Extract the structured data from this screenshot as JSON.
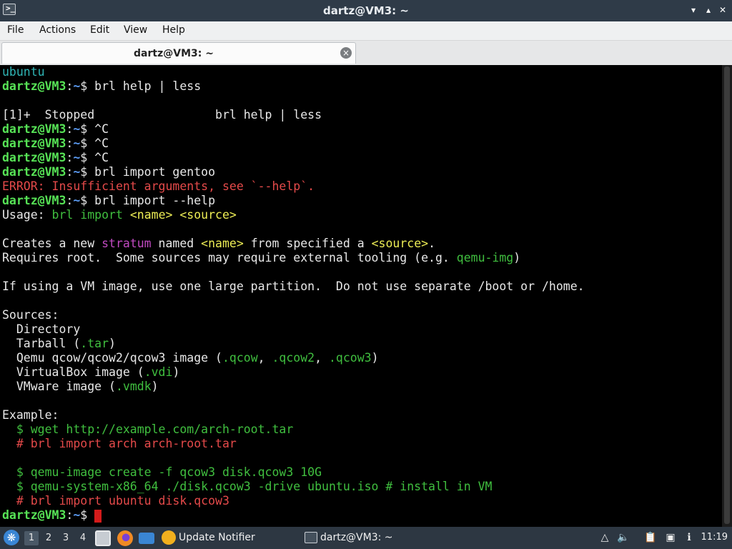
{
  "window": {
    "title": "dartz@VM3: ~",
    "app_icon_glyph": ">_"
  },
  "menu": {
    "items": [
      "File",
      "Actions",
      "Edit",
      "View",
      "Help"
    ]
  },
  "tab": {
    "label": "dartz@VM3: ~",
    "close_glyph": "×"
  },
  "terminal": {
    "user_host": "dartz@VM3",
    "path": "~",
    "lines": [
      [
        {
          "t": "ubuntu",
          "c": "cy"
        }
      ],
      [
        {
          "t": "dartz@VM3",
          "c": "pu"
        },
        {
          "t": ":",
          "c": ""
        },
        {
          "t": "~",
          "c": "pp"
        },
        {
          "t": "$ brl help | less",
          "c": ""
        }
      ],
      [
        {
          "t": "",
          "c": ""
        }
      ],
      [
        {
          "t": "[1]+  Stopped                 brl help | less",
          "c": ""
        }
      ],
      [
        {
          "t": "dartz@VM3",
          "c": "pu"
        },
        {
          "t": ":",
          "c": ""
        },
        {
          "t": "~",
          "c": "pp"
        },
        {
          "t": "$ ^C",
          "c": ""
        }
      ],
      [
        {
          "t": "dartz@VM3",
          "c": "pu"
        },
        {
          "t": ":",
          "c": ""
        },
        {
          "t": "~",
          "c": "pp"
        },
        {
          "t": "$ ^C",
          "c": ""
        }
      ],
      [
        {
          "t": "dartz@VM3",
          "c": "pu"
        },
        {
          "t": ":",
          "c": ""
        },
        {
          "t": "~",
          "c": "pp"
        },
        {
          "t": "$ ^C",
          "c": ""
        }
      ],
      [
        {
          "t": "dartz@VM3",
          "c": "pu"
        },
        {
          "t": ":",
          "c": ""
        },
        {
          "t": "~",
          "c": "pp"
        },
        {
          "t": "$ brl import gentoo",
          "c": ""
        }
      ],
      [
        {
          "t": "ERROR: Insufficient arguments, see `--help`.",
          "c": "rd"
        }
      ],
      [
        {
          "t": "dartz@VM3",
          "c": "pu"
        },
        {
          "t": ":",
          "c": ""
        },
        {
          "t": "~",
          "c": "pp"
        },
        {
          "t": "$ brl import --help",
          "c": ""
        }
      ],
      [
        {
          "t": "Usage: ",
          "c": ""
        },
        {
          "t": "brl import",
          "c": "gr"
        },
        {
          "t": " ",
          "c": ""
        },
        {
          "t": "<name>",
          "c": "yl"
        },
        {
          "t": " ",
          "c": ""
        },
        {
          "t": "<source>",
          "c": "yl"
        }
      ],
      [
        {
          "t": "",
          "c": ""
        }
      ],
      [
        {
          "t": "Creates a new ",
          "c": ""
        },
        {
          "t": "stratum",
          "c": "mg"
        },
        {
          "t": " named ",
          "c": ""
        },
        {
          "t": "<name>",
          "c": "yl"
        },
        {
          "t": " from specified a ",
          "c": ""
        },
        {
          "t": "<source>",
          "c": "yl"
        },
        {
          "t": ".",
          "c": ""
        }
      ],
      [
        {
          "t": "Requires root.  Some sources may require external tooling (e.g. ",
          "c": ""
        },
        {
          "t": "qemu-img",
          "c": "gr"
        },
        {
          "t": ")",
          "c": ""
        }
      ],
      [
        {
          "t": "",
          "c": ""
        }
      ],
      [
        {
          "t": "If using a VM image, use one large partition.  Do not use separate /boot or /home.",
          "c": ""
        }
      ],
      [
        {
          "t": "",
          "c": ""
        }
      ],
      [
        {
          "t": "Sources:",
          "c": ""
        }
      ],
      [
        {
          "t": "  Directory",
          "c": ""
        }
      ],
      [
        {
          "t": "  Tarball (",
          "c": ""
        },
        {
          "t": ".tar",
          "c": "gr"
        },
        {
          "t": ")",
          "c": ""
        }
      ],
      [
        {
          "t": "  Qemu qcow/qcow2/qcow3 image (",
          "c": ""
        },
        {
          "t": ".qcow",
          "c": "gr"
        },
        {
          "t": ", ",
          "c": ""
        },
        {
          "t": ".qcow2",
          "c": "gr"
        },
        {
          "t": ", ",
          "c": ""
        },
        {
          "t": ".qcow3",
          "c": "gr"
        },
        {
          "t": ")",
          "c": ""
        }
      ],
      [
        {
          "t": "  VirtualBox image (",
          "c": ""
        },
        {
          "t": ".vdi",
          "c": "gr"
        },
        {
          "t": ")",
          "c": ""
        }
      ],
      [
        {
          "t": "  VMware image (",
          "c": ""
        },
        {
          "t": ".vmdk",
          "c": "gr"
        },
        {
          "t": ")",
          "c": ""
        }
      ],
      [
        {
          "t": "",
          "c": ""
        }
      ],
      [
        {
          "t": "Example:",
          "c": ""
        }
      ],
      [
        {
          "t": "  $ wget http://example.com/arch-root.tar",
          "c": "gr"
        }
      ],
      [
        {
          "t": "  # brl import arch arch-root.tar",
          "c": "rd"
        }
      ],
      [
        {
          "t": "",
          "c": ""
        }
      ],
      [
        {
          "t": "  $ qemu-image create -f qcow3 disk.qcow3 10G",
          "c": "gr"
        }
      ],
      [
        {
          "t": "  $ qemu-system-x86_64 ./disk.qcow3 -drive ubuntu.iso # install in VM",
          "c": "gr"
        }
      ],
      [
        {
          "t": "  # brl import ubuntu disk.qcow3",
          "c": "rd"
        }
      ],
      [
        {
          "t": "dartz@VM3",
          "c": "pu"
        },
        {
          "t": ":",
          "c": ""
        },
        {
          "t": "~",
          "c": "pp"
        },
        {
          "t": "$ ",
          "c": ""
        },
        {
          "t": "",
          "c": "cursor"
        }
      ]
    ]
  },
  "taskbar": {
    "workspaces": [
      "1",
      "2",
      "3",
      "4"
    ],
    "active_workspace": "1",
    "tasks": [
      "Update Notifier",
      "dartz@VM3: ~"
    ],
    "clock": "11:19",
    "colors": {
      "accent": "#3a86d4",
      "prompt_user": "#57e356",
      "prompt_path": "#5b9bf3",
      "error": "#e54a4a"
    }
  }
}
